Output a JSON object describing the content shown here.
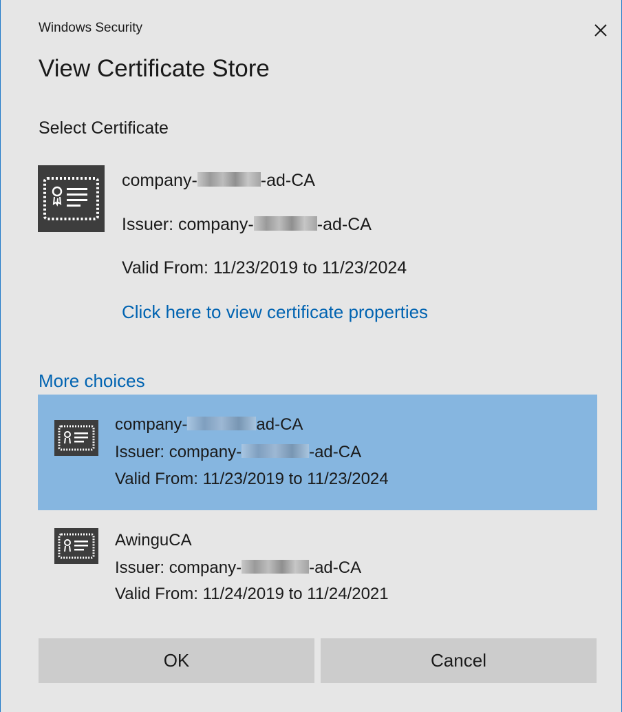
{
  "window": {
    "title": "Windows Security",
    "close_icon": "close-icon"
  },
  "heading": "View Certificate Store",
  "select_label": "Select Certificate",
  "selected": {
    "icon": "certificate-icon",
    "name_prefix": "company-",
    "name_suffix": "-ad-CA",
    "issuer_prefix": "Issuer: company-",
    "issuer_suffix": "-ad-CA",
    "valid": "Valid From: 11/23/2019 to 11/23/2024",
    "properties_link": "Click here to view certificate properties"
  },
  "more_choices": "More choices",
  "choices": [
    {
      "name_prefix": "company-",
      "name_suffix": "ad-CA",
      "issuer_prefix": "Issuer: company-",
      "issuer_suffix": "-ad-CA",
      "valid": "Valid From: 11/23/2019 to 11/23/2024",
      "selected": true
    },
    {
      "name": "AwinguCA",
      "issuer_prefix": "Issuer: company-",
      "issuer_suffix": "-ad-CA",
      "valid": "Valid From: 11/24/2019 to 11/24/2021",
      "selected": false
    }
  ],
  "buttons": {
    "ok": "OK",
    "cancel": "Cancel"
  },
  "colors": {
    "accent": "#0063b1",
    "selection": "#86b6e0",
    "background": "#e6e6e6",
    "button": "#cccccc",
    "border": "#1e78c8"
  }
}
